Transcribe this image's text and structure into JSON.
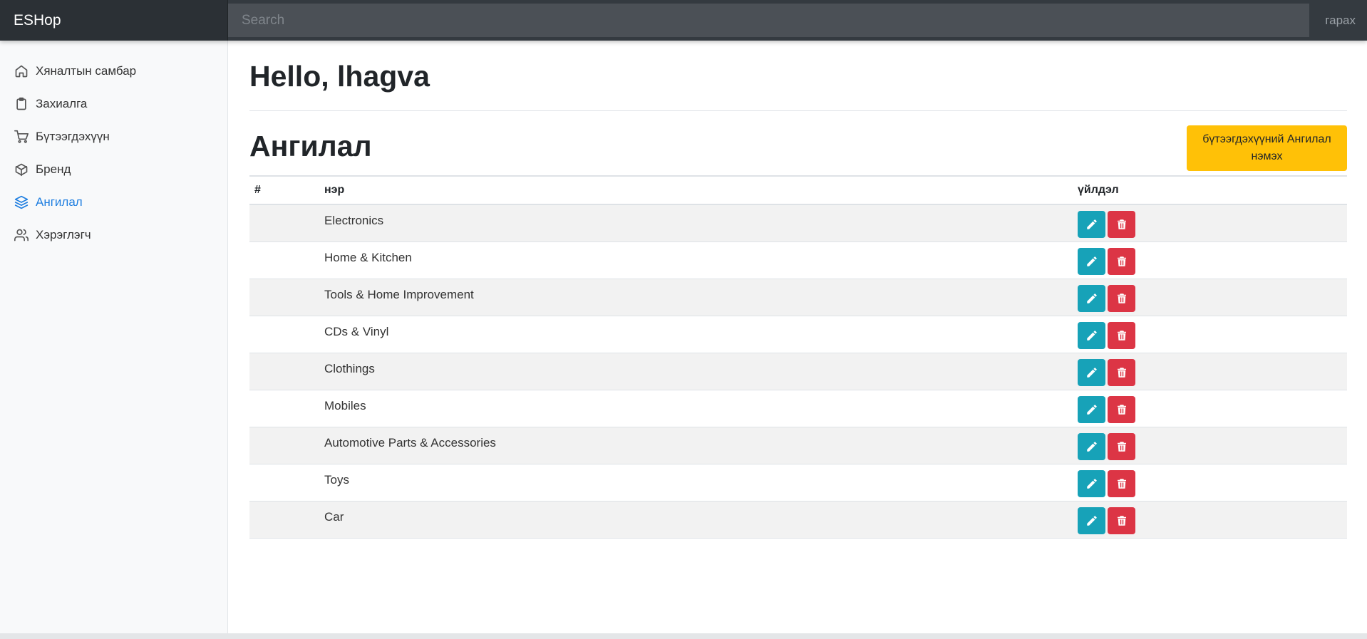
{
  "navbar": {
    "brand": "ESHop",
    "search_placeholder": "Search",
    "signout": "гарах"
  },
  "sidebar": {
    "items": [
      {
        "label": "Хяналтын самбар",
        "icon": "home-icon",
        "active": false
      },
      {
        "label": "Захиалга",
        "icon": "clipboard-icon",
        "active": false
      },
      {
        "label": "Бүтээгдэхүүн",
        "icon": "cart-icon",
        "active": false
      },
      {
        "label": "Бренд",
        "icon": "box-icon",
        "active": false
      },
      {
        "label": "Ангилал",
        "icon": "layers-icon",
        "active": true
      },
      {
        "label": "Хэрэглэгч",
        "icon": "users-icon",
        "active": false
      }
    ]
  },
  "main": {
    "greeting": "Hello, lhagva",
    "section_title": "Ангилал",
    "add_button": "бүтээгдэхүүний Ангилал нэмэх",
    "table": {
      "headers": [
        "#",
        "нэр",
        "үйлдэл"
      ],
      "rows": [
        {
          "num": "",
          "name": "Electronics"
        },
        {
          "num": "",
          "name": "Home & Kitchen"
        },
        {
          "num": "",
          "name": "Tools & Home Improvement"
        },
        {
          "num": "",
          "name": "CDs & Vinyl"
        },
        {
          "num": "",
          "name": "Clothings"
        },
        {
          "num": "",
          "name": "Mobiles"
        },
        {
          "num": "",
          "name": "Automotive Parts & Accessories"
        },
        {
          "num": "",
          "name": "Toys"
        },
        {
          "num": "",
          "name": "Car"
        }
      ]
    }
  },
  "colors": {
    "navbar": "#343a40",
    "active_link": "#1e7ee0",
    "add_button": "#ffc107",
    "edit_button": "#17a2b8",
    "delete_button": "#dc3545"
  }
}
